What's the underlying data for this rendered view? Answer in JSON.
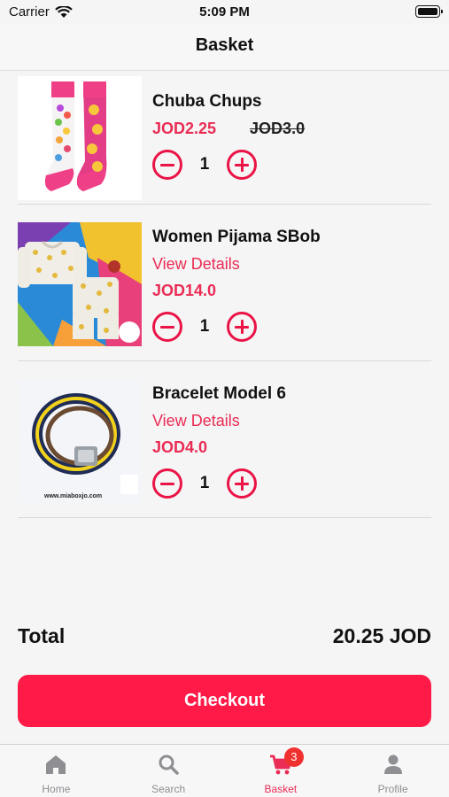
{
  "status_bar": {
    "carrier": "Carrier",
    "time": "5:09 PM"
  },
  "nav": {
    "title": "Basket"
  },
  "items": [
    {
      "name": "Chuba Chups",
      "price": "JOD2.25",
      "old_price": "JOD3.0",
      "quantity": "1",
      "image": "socks-product-image"
    },
    {
      "name": "Women Pijama SBob",
      "view_details": "View Details",
      "price": "JOD14.0",
      "quantity": "1",
      "image": "pajama-product-image"
    },
    {
      "name": "Bracelet Model 6",
      "view_details": "View Details",
      "price": "JOD4.0",
      "quantity": "1",
      "image": "bracelet-product-image",
      "image_watermark": "www.miaboxjo.com"
    }
  ],
  "summary": {
    "total_label": "Total",
    "total_value": "20.25 JOD"
  },
  "checkout": {
    "label": "Checkout"
  },
  "tab_bar": {
    "tabs": [
      {
        "label": "Home",
        "icon": "home-icon"
      },
      {
        "label": "Search",
        "icon": "search-icon"
      },
      {
        "label": "Basket",
        "icon": "cart-icon",
        "badge": "3",
        "active": true
      },
      {
        "label": "Profile",
        "icon": "person-icon"
      }
    ]
  },
  "colors": {
    "accent": "#ea2c55",
    "checkout": "#ff1a47",
    "badge": "#f0302e",
    "inactive_tab": "#8e8e93"
  }
}
